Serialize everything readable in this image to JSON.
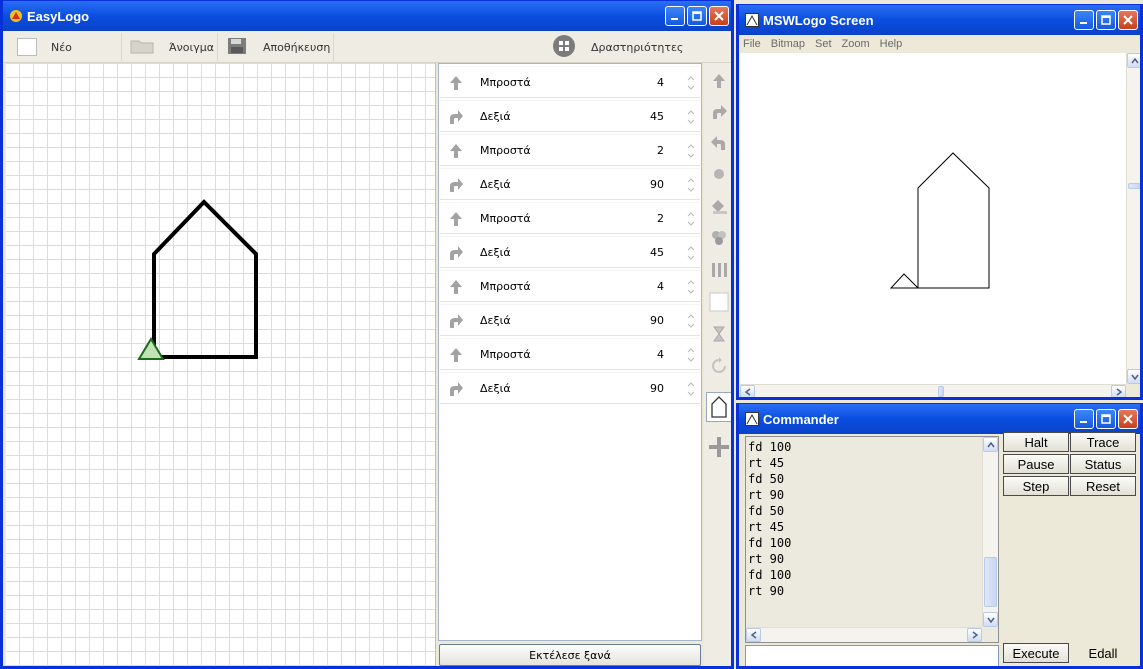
{
  "easylogo": {
    "title": "EasyLogo",
    "toolbar": {
      "new_label": "Νέο",
      "open_label": "Άνοιγμα",
      "save_label": "Αποθήκευση",
      "activities_label": "Δραστηριότητες"
    },
    "commands": [
      {
        "label": "Μπροστά",
        "value": "4",
        "icon": "arrow-up-icon"
      },
      {
        "label": "Δεξιά",
        "value": "45",
        "icon": "turn-right-icon"
      },
      {
        "label": "Μπροστά",
        "value": "2",
        "icon": "arrow-up-icon"
      },
      {
        "label": "Δεξιά",
        "value": "90",
        "icon": "turn-right-icon"
      },
      {
        "label": "Μπροστά",
        "value": "2",
        "icon": "arrow-up-icon"
      },
      {
        "label": "Δεξιά",
        "value": "45",
        "icon": "turn-right-icon"
      },
      {
        "label": "Μπροστά",
        "value": "4",
        "icon": "arrow-up-icon"
      },
      {
        "label": "Δεξιά",
        "value": "90",
        "icon": "turn-right-icon"
      },
      {
        "label": "Μπροστά",
        "value": "4",
        "icon": "arrow-up-icon"
      },
      {
        "label": "Δεξιά",
        "value": "90",
        "icon": "turn-right-icon"
      }
    ],
    "run_again_label": "Εκτέλεσε ξανά",
    "accent": "#0a4ee0"
  },
  "msw": {
    "title": "MSWLogo Screen",
    "menu": [
      "File",
      "Bitmap",
      "Set",
      "Zoom",
      "Help"
    ]
  },
  "commander": {
    "title": "Commander",
    "history": [
      "fd 100",
      "rt 45",
      "fd 50",
      "rt 90",
      "fd 50",
      "rt 45",
      "fd 100",
      "rt 90",
      "fd 100",
      "rt 90"
    ],
    "buttons": {
      "halt": "Halt",
      "trace": "Trace",
      "pause": "Pause",
      "status": "Status",
      "step": "Step",
      "reset": "Reset",
      "execute": "Execute",
      "edall": "Edall"
    },
    "input_value": ""
  }
}
